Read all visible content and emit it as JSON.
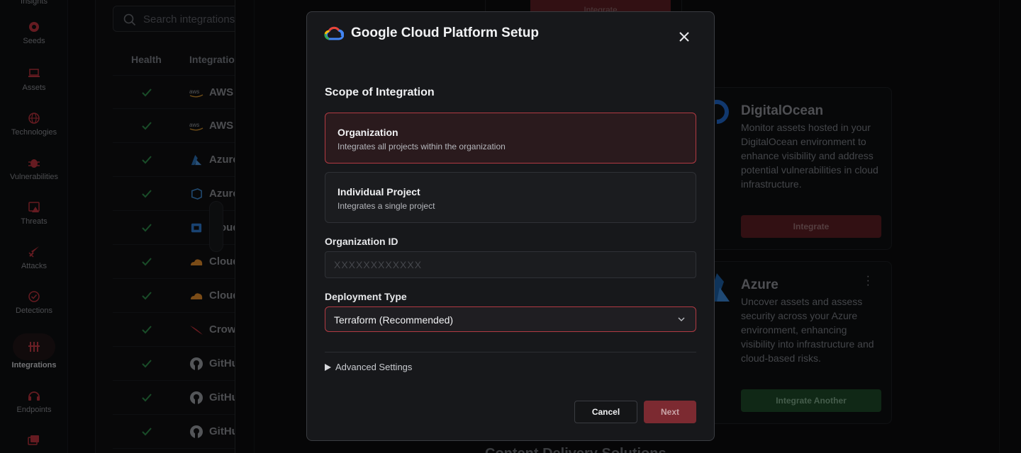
{
  "sidebar": {
    "items": [
      {
        "label": "Insights"
      },
      {
        "label": "Seeds"
      },
      {
        "label": "Assets"
      },
      {
        "label": "Technologies"
      },
      {
        "label": "Vulnerabilities"
      },
      {
        "label": "Threats"
      },
      {
        "label": "Attacks"
      },
      {
        "label": "Detections"
      },
      {
        "label": "Integrations"
      },
      {
        "label": "Endpoints"
      }
    ]
  },
  "integrations_list": {
    "search_placeholder": "Search integrations",
    "columns": [
      "Health",
      "Integration"
    ],
    "rows": [
      {
        "name": "AWS"
      },
      {
        "name": "AWS"
      },
      {
        "name": "Azure"
      },
      {
        "name": "Azure"
      },
      {
        "name": "Cloud"
      },
      {
        "name": "Cloud"
      },
      {
        "name": "Cloud"
      },
      {
        "name": "Crow"
      },
      {
        "name": "GitHu"
      },
      {
        "name": "GitHu"
      },
      {
        "name": "GitHu"
      }
    ]
  },
  "cards": {
    "top_button": "Integrate",
    "digitalocean": {
      "title": "DigitalOcean",
      "description": "Monitor assets hosted in your DigitalOcean environment to enhance visibility and address potential vulnerabilities in cloud infrastructure.",
      "button": "Integrate"
    },
    "azure": {
      "title": "Azure",
      "description": "Uncover assets and assess security across your Azure environment, enhancing visibility into infrastructure and cloud-based risks.",
      "button": "Integrate Another"
    },
    "bottom_heading": "Content Delivery Solutions"
  },
  "modal": {
    "title": "Google Cloud Platform Setup",
    "scope_heading": "Scope of Integration",
    "options": [
      {
        "title": "Organization",
        "description": "Integrates all projects within the organization",
        "selected": true
      },
      {
        "title": "Individual Project",
        "description": "Integrates a single project",
        "selected": false
      }
    ],
    "org_id": {
      "label": "Organization ID",
      "placeholder": "XXXXXXXXXXXX",
      "value": ""
    },
    "deployment": {
      "label": "Deployment Type",
      "selected": "Terraform (Recommended)"
    },
    "advanced_label": "Advanced Settings",
    "cancel_label": "Cancel",
    "next_label": "Next"
  },
  "colors": {
    "accent": "#b23a43",
    "next_button": "#7c2a31",
    "integrate_button": "#5c1e23",
    "integrate_another_button": "#1e4a28",
    "health_check": "#2e8b4a"
  }
}
